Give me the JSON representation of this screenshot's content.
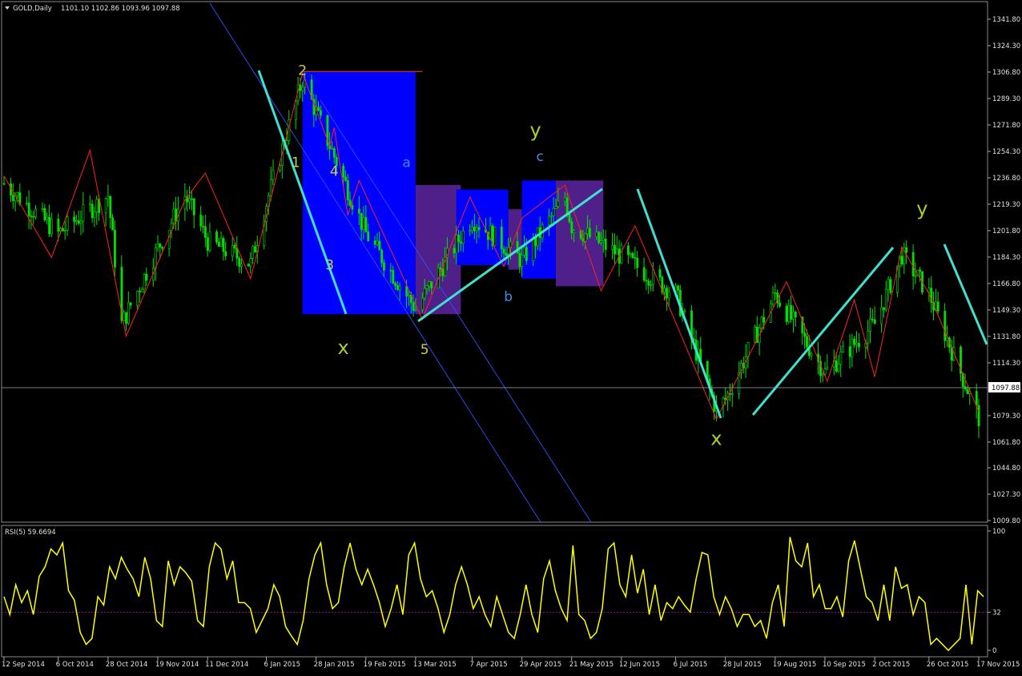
{
  "main_header": {
    "symbol": "GOLD,Daily",
    "ohlc": "1101.10 1102.86 1093.96 1097.88"
  },
  "rsi_header": {
    "label": "RSI(5) 59.6694"
  },
  "current_price_label": "1097.88",
  "chart_data": [
    {
      "type": "candlestick",
      "name": "GOLD,Daily",
      "price_axis_ticks": [
        "1341.80",
        "1324.30",
        "1306.80",
        "1289.30",
        "1271.80",
        "1254.30",
        "1236.80",
        "1219.30",
        "1201.80",
        "1184.30",
        "1166.80",
        "1149.30",
        "1131.80",
        "1114.30",
        "1097.88",
        "1079.30",
        "1061.80",
        "1044.80",
        "1027.30",
        "1009.80"
      ],
      "date_axis_ticks": [
        "12 Sep 2014",
        "6 Oct 2014",
        "28 Oct 2014",
        "19 Nov 2014",
        "11 Dec 2014",
        "6 Jan 2015",
        "28 Jan 2015",
        "19 Feb 2015",
        "13 Mar 2015",
        "7 Apr 2015",
        "29 Apr 2015",
        "21 May 2015",
        "12 Jun 2015",
        "6 Jul 2015",
        "28 Jul 2015",
        "19 Aug 2015",
        "10 Sep 2015",
        "2 Oct 2015",
        "26 Oct 2015",
        "17 Nov 2015"
      ],
      "ylim": [
        1004,
        1347
      ],
      "last_price": 1097.88,
      "series": [
        {
          "date": "12 Sep 2014",
          "value": 1233
        },
        {
          "date": "6 Oct 2014",
          "value": 1200
        },
        {
          "date": "28 Oct 2014",
          "value": 1225
        },
        {
          "date": "3 Nov 2014",
          "value": 1140
        },
        {
          "date": "19 Nov 2014",
          "value": 1190
        },
        {
          "date": "1 Dec 2014",
          "value": 1225
        },
        {
          "date": "11 Dec 2014",
          "value": 1195
        },
        {
          "date": "30 Dec 2014",
          "value": 1180
        },
        {
          "date": "6 Jan 2015",
          "value": 1220
        },
        {
          "date": "22 Jan 2015",
          "value": 1302
        },
        {
          "date": "28 Jan 2015",
          "value": 1280
        },
        {
          "date": "19 Feb 2015",
          "value": 1200
        },
        {
          "date": "13 Mar 2015",
          "value": 1150
        },
        {
          "date": "7 Apr 2015",
          "value": 1210
        },
        {
          "date": "29 Apr 2015",
          "value": 1182
        },
        {
          "date": "18 May 2015",
          "value": 1224
        },
        {
          "date": "21 May 2015",
          "value": 1205
        },
        {
          "date": "12 Jun 2015",
          "value": 1185
        },
        {
          "date": "6 Jul 2015",
          "value": 1160
        },
        {
          "date": "24 Jul 2015",
          "value": 1083
        },
        {
          "date": "28 Jul 2015",
          "value": 1090
        },
        {
          "date": "19 Aug 2015",
          "value": 1160
        },
        {
          "date": "10 Sep 2015",
          "value": 1108
        },
        {
          "date": "2 Oct 2015",
          "value": 1140
        },
        {
          "date": "14 Oct 2015",
          "value": 1186
        },
        {
          "date": "26 Oct 2015",
          "value": 1160
        },
        {
          "date": "17 Nov 2015",
          "value": 1078
        }
      ],
      "annotations": [
        {
          "text": "2",
          "date": "22 Jan 2015",
          "price": 1305,
          "color": "#c8d048"
        },
        {
          "text": "1",
          "date": "19 Jan 2015",
          "price": 1244,
          "color": "#c8d048"
        },
        {
          "text": "4",
          "date": "5 Feb 2015",
          "price": 1238,
          "color": "#c8d048"
        },
        {
          "text": "3",
          "date": "3 Feb 2015",
          "price": 1176,
          "color": "#c8d048"
        },
        {
          "text": "5",
          "date": "17 Mar 2015",
          "price": 1120,
          "color": "#c8d048"
        },
        {
          "text": "x",
          "date": "9 Feb 2015",
          "price": 1120,
          "color": "#a8d030"
        },
        {
          "text": "a",
          "date": "9 Mar 2015",
          "price": 1244,
          "color": "#3a8fe6"
        },
        {
          "text": "b",
          "date": "23 Apr 2015",
          "price": 1155,
          "color": "#3a8fe6"
        },
        {
          "text": "c",
          "date": "7 May 2015",
          "price": 1248,
          "color": "#3a8fe6"
        },
        {
          "text": "y",
          "date": "5 May 2015",
          "price": 1264,
          "color": "#a8d030"
        },
        {
          "text": "x",
          "date": "24 Jul 2015",
          "price": 1060,
          "color": "#a8d030"
        },
        {
          "text": "y",
          "date": "23 Oct 2015",
          "price": 1212,
          "color": "#a8d030"
        }
      ],
      "colors": {
        "candles": "#00e000",
        "zigzag": "#ff2020",
        "trendlines": "#40e0d0",
        "channel": "#3050ff",
        "box_blue": "#0000ff",
        "box_purple": "#50208a",
        "header_text": "#e0e0e0"
      }
    },
    {
      "type": "line",
      "name": "RSI(5)",
      "current_value": 59.6694,
      "ylim": [
        0,
        100
      ],
      "y_ticks": [
        "100",
        "32",
        "0"
      ],
      "level": 32,
      "series_color": "#ffff00",
      "level_color": "#c000c0",
      "values": [
        45,
        30,
        55,
        40,
        50,
        30,
        62,
        70,
        85,
        80,
        90,
        50,
        42,
        15,
        5,
        10,
        45,
        38,
        70,
        60,
        78,
        68,
        60,
        45,
        78,
        60,
        25,
        20,
        75,
        55,
        70,
        65,
        58,
        25,
        20,
        70,
        90,
        85,
        60,
        75,
        40,
        40,
        35,
        15,
        25,
        35,
        55,
        45,
        20,
        12,
        5,
        25,
        60,
        80,
        90,
        55,
        35,
        40,
        70,
        90,
        68,
        55,
        68,
        55,
        40,
        20,
        35,
        55,
        30,
        80,
        90,
        60,
        45,
        50,
        35,
        15,
        30,
        55,
        70,
        55,
        35,
        45,
        30,
        20,
        45,
        30,
        15,
        10,
        30,
        55,
        30,
        15,
        60,
        75,
        50,
        35,
        25,
        88,
        30,
        25,
        10,
        15,
        35,
        85,
        90,
        55,
        45,
        80,
        48,
        68,
        30,
        55,
        25,
        40,
        35,
        45,
        38,
        32,
        60,
        82,
        80,
        45,
        30,
        45,
        35,
        20,
        30,
        30,
        20,
        25,
        10,
        40,
        55,
        20,
        95,
        75,
        70,
        90,
        45,
        55,
        35,
        35,
        45,
        28,
        75,
        92,
        68,
        45,
        40,
        25,
        55,
        25,
        70,
        52,
        55,
        30,
        45,
        40,
        5,
        10,
        5,
        0,
        5,
        10,
        55,
        5,
        50,
        45
      ]
    }
  ]
}
